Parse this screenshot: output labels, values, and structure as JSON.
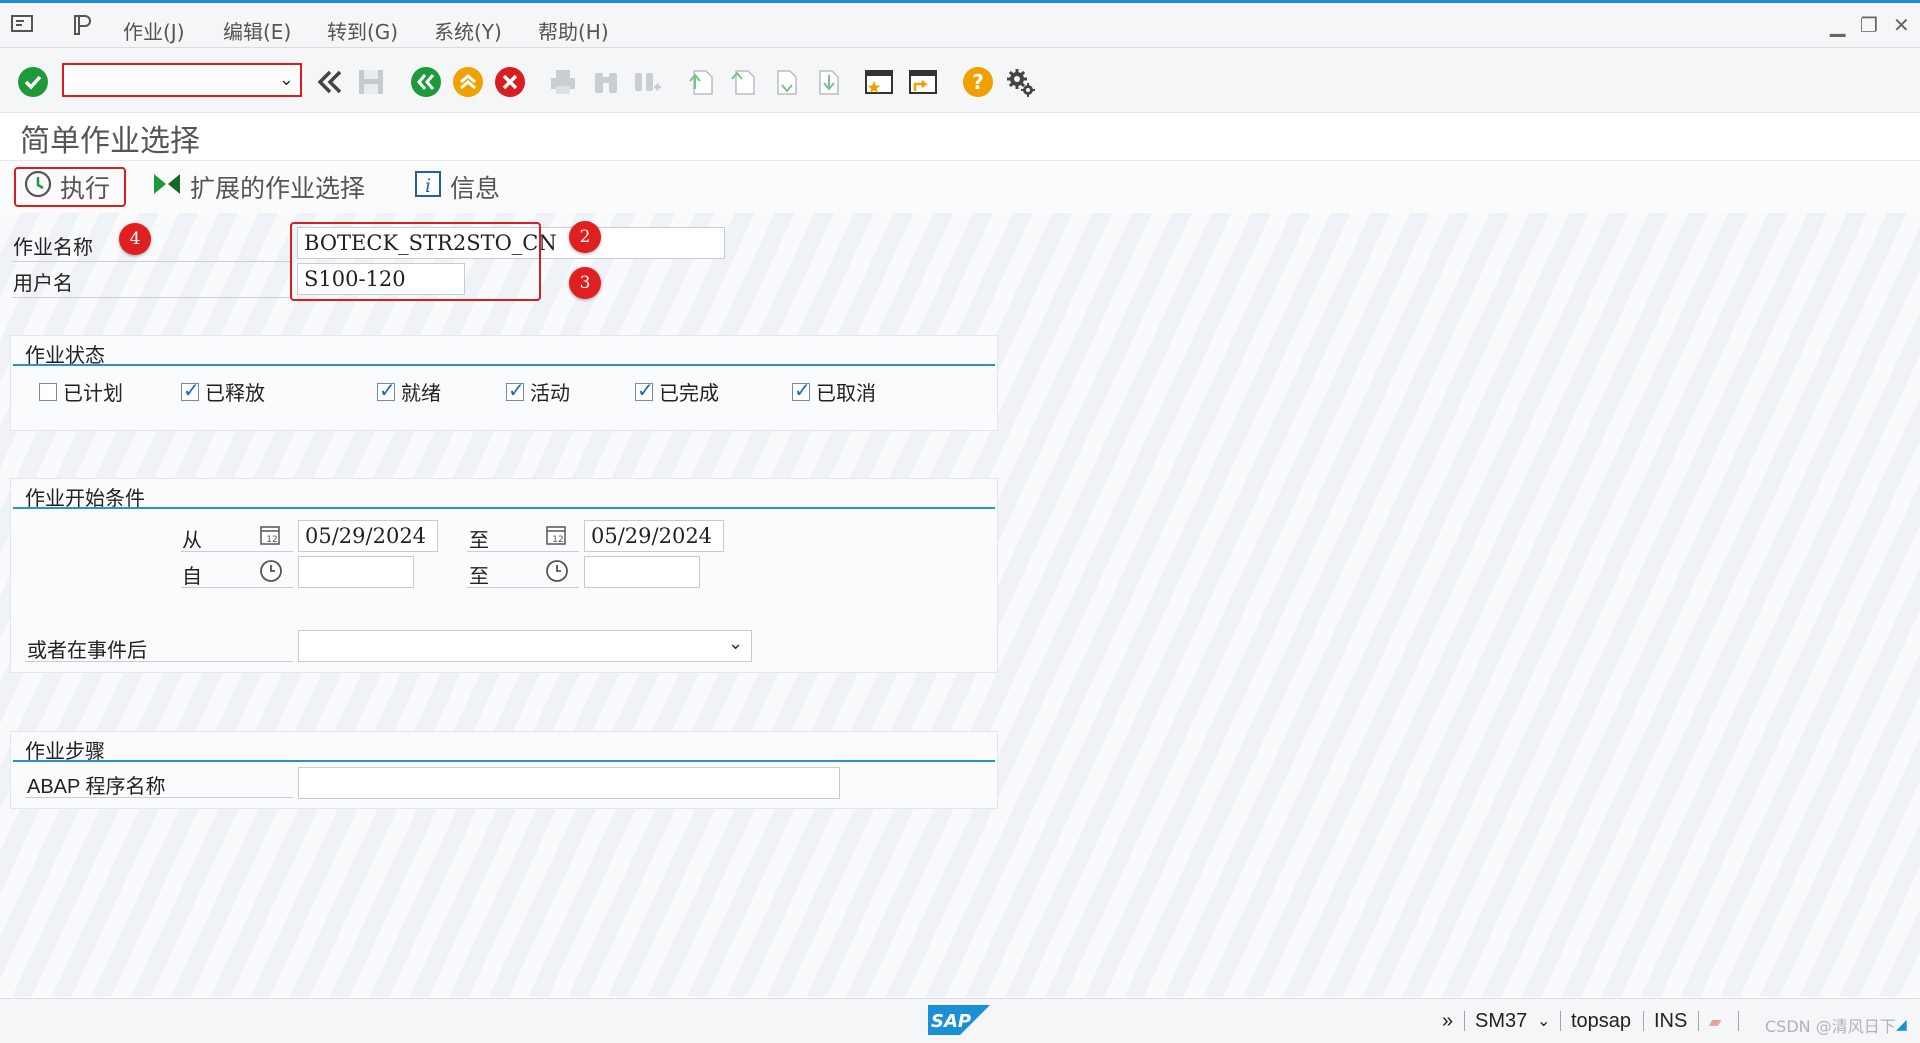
{
  "menu": {
    "items": [
      "作业(J)",
      "编辑(E)",
      "转到(G)",
      "系统(Y)",
      "帮助(H)"
    ]
  },
  "toolbar": {
    "command_value": ""
  },
  "page": {
    "title": "简单作业选择"
  },
  "app_toolbar": {
    "execute_label": "执行",
    "extended_label": "扩展的作业选择",
    "info_label": "信息"
  },
  "job_name": {
    "label": "作业名称",
    "value": "BOTECK_STR2STO_CN"
  },
  "user_name": {
    "label": "用户名",
    "value": "S100-120"
  },
  "badges": [
    "4",
    "2",
    "3"
  ],
  "job_status": {
    "title": "作业状态",
    "options": [
      {
        "label": "已计划",
        "checked": false
      },
      {
        "label": "已释放",
        "checked": true
      },
      {
        "label": "就绪",
        "checked": true
      },
      {
        "label": "活动",
        "checked": true
      },
      {
        "label": "已完成",
        "checked": true
      },
      {
        "label": "已取消",
        "checked": true
      }
    ]
  },
  "start_condition": {
    "title": "作业开始条件",
    "from_date_label": "从",
    "from_date": "05/29/2024",
    "to_date_label": "至",
    "to_date": "05/29/2024",
    "from_time_label": "自",
    "from_time": "",
    "to_time_label": "至",
    "to_time": "",
    "event_label": "或者在事件后",
    "event_value": ""
  },
  "job_step": {
    "title": "作业步骤",
    "program_label": "ABAP 程序名称",
    "program_value": ""
  },
  "status": {
    "arrows": "»",
    "transaction": "SM37",
    "server": "topsap",
    "mode": "INS",
    "watermark": "CSDN @清风日下"
  },
  "colors": {
    "accent": "#2f8fd1",
    "highlight": "#d81e1e",
    "green": "#1f9a3a",
    "orange": "#f0a000"
  }
}
